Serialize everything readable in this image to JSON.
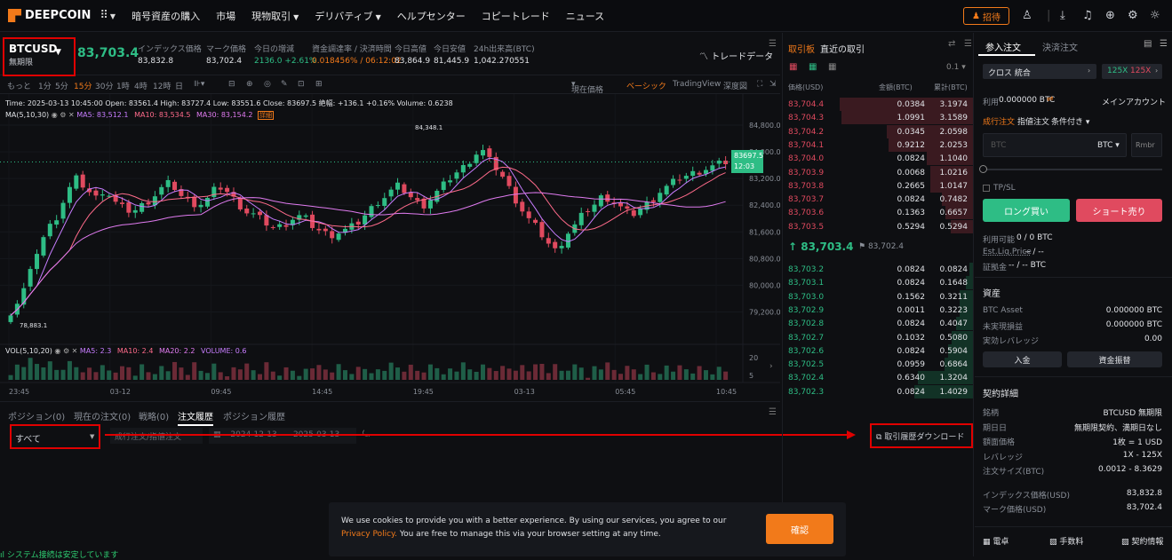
{
  "nav": {
    "logo": "DEEPCOIN",
    "items": [
      "暗号資産の購入",
      "市場",
      "現物取引",
      "デリバティブ",
      "ヘルプセンター",
      "コピートレード",
      "ニュース"
    ],
    "invite": "招待"
  },
  "symbol": {
    "name": "BTCUSD",
    "sub": "無期限",
    "price": "83,703.4",
    "stats": [
      {
        "label": "インデックス価格",
        "value": "83,832.8"
      },
      {
        "label": "マーク価格",
        "value": "83,702.4"
      },
      {
        "label": "今日の増減",
        "value": "2136.0 +2.61%"
      },
      {
        "label": "資金調達率 / 決済時間",
        "value": "0.018456% / 06:12:02"
      },
      {
        "label": "今日高値",
        "value": "83,864.9"
      },
      {
        "label": "今日安値",
        "value": "81,445.9"
      },
      {
        "label": "24h出来高(BTC)",
        "value": "1,042.270551"
      }
    ],
    "trade_data": "トレードデータ"
  },
  "toolbar": {
    "intervals": [
      "もっと",
      "1分",
      "5分",
      "15分",
      "30分",
      "1時",
      "4時",
      "12時",
      "日"
    ],
    "current_price": "現在価格",
    "basic": "ベーシック",
    "tradingview": "TradingView",
    "depth": "深度図"
  },
  "chart_info": {
    "line1": "Time: 2025-03-13 10:45:00   Open: 83561.4   High: 83727.4   Low: 83551.6   Close: 83697.5   絶幅: +136.1 +0.16%   Volume: 0.6238",
    "ma_label": "MA(5,10,30)",
    "ma5": "MA5: 83,512.1",
    "ma10": "MA10: 83,534.5",
    "ma30": "MA30: 83,154.2",
    "badge": "詳細",
    "vol_label": "VOL(5,10,20)",
    "vma5": "MA5: 2.3",
    "vma10": "MA10: 2.4",
    "vma20": "MA20: 2.2",
    "volume": "VOLUME: 0.6",
    "high_mark": "84,348.1",
    "low_mark": "78,883.1",
    "last_price": "83697.5",
    "last_time": "12:03"
  },
  "chart_data": {
    "type": "candlestick",
    "y_ticks": [
      "84,800.0",
      "84,000.0",
      "83,200.0",
      "82,400.0",
      "81,600.0",
      "80,800.0",
      "80,000.0",
      "79,200.0"
    ],
    "y_range": [
      78600,
      85200
    ],
    "x_ticks": [
      "23:45",
      "03-12",
      "09:45",
      "14:45",
      "19:45",
      "03-13",
      "05:45",
      "10:45"
    ],
    "vol_ticks": [
      "20",
      "5"
    ],
    "close": [
      79200,
      79600,
      80300,
      81200,
      81700,
      82100,
      82800,
      83200,
      82900,
      82600,
      82900,
      82500,
      82300,
      82200,
      82400,
      82600,
      82900,
      83100,
      82700,
      82500,
      82400,
      82600,
      83000,
      82800,
      82500,
      82200,
      82100,
      81900,
      81700,
      81800,
      82000,
      82100,
      81800,
      81600,
      81500,
      81600,
      81700,
      81900,
      82200,
      82500,
      82700,
      83000,
      82800,
      82500,
      82400,
      82700,
      83000,
      83300,
      83500,
      83800,
      84100,
      83700,
      83400,
      82900,
      82400,
      82000,
      81700,
      81300,
      81000,
      81500,
      81800,
      82200,
      82400,
      82700,
      82500,
      82300,
      82100,
      82300,
      82500,
      82800,
      83000,
      83200,
      83300,
      83400,
      83500,
      83600,
      83700
    ]
  },
  "bottom": {
    "tabs": [
      "ポジション(0)",
      "現在の注文(0)",
      "戦略(0)",
      "注文履歴",
      "ポジション履歴"
    ],
    "filter_all": "すべて",
    "order_type": "成行注文/指値注文",
    "date_from": "2024-12-13",
    "date_to": "2025-03-13",
    "download": "取引履歴ダウンロード"
  },
  "orderbook": {
    "tab1": "取引板",
    "tab2": "直近の取引",
    "precision": "0.1",
    "headers": [
      "価格(USD)",
      "金額(BTC)",
      "累計(BTC)"
    ],
    "asks": [
      [
        "83,704.4",
        "0.0384",
        "3.1974"
      ],
      [
        "83,704.3",
        "1.0991",
        "3.1589"
      ],
      [
        "83,704.2",
        "0.0345",
        "2.0598"
      ],
      [
        "83,704.1",
        "0.9212",
        "2.0253"
      ],
      [
        "83,704.0",
        "0.0824",
        "1.1040"
      ],
      [
        "83,703.9",
        "0.0068",
        "1.0216"
      ],
      [
        "83,703.8",
        "0.2665",
        "1.0147"
      ],
      [
        "83,703.7",
        "0.0824",
        "0.7482"
      ],
      [
        "83,703.6",
        "0.1363",
        "0.6657"
      ],
      [
        "83,703.5",
        "0.5294",
        "0.5294"
      ]
    ],
    "mid_price": "83,703.4",
    "mid_mark": "83,702.4",
    "bids": [
      [
        "83,703.2",
        "0.0824",
        "0.0824"
      ],
      [
        "83,703.1",
        "0.0824",
        "0.1648"
      ],
      [
        "83,703.0",
        "0.1562",
        "0.3211"
      ],
      [
        "83,702.9",
        "0.0011",
        "0.3223"
      ],
      [
        "83,702.8",
        "0.0824",
        "0.4047"
      ],
      [
        "83,702.7",
        "0.1032",
        "0.5080"
      ],
      [
        "83,702.6",
        "0.0824",
        "0.5904"
      ],
      [
        "83,702.5",
        "0.0959",
        "0.6864"
      ],
      [
        "83,702.4",
        "0.6340",
        "1.3204"
      ],
      [
        "83,702.3",
        "0.0824",
        "1.4029"
      ]
    ]
  },
  "order_panel": {
    "tab1": "参入注文",
    "tab2": "決済注文",
    "margin_mode": "クロス 統合",
    "leverage1": "125X",
    "leverage2": "125X",
    "available_label": "利用",
    "available_value": "0.000000 BTC",
    "main_account": "メインアカウント",
    "order_types": [
      "成行注文",
      "指値注文",
      "条件付き"
    ],
    "qty_placeholder": "BTC",
    "qty_unit": "BTC",
    "rmb": "Rmbr",
    "tpsl": "TP/SL",
    "long": "ロング買い",
    "short": "ショート売り",
    "avail_line": "利用可能",
    "avail_vals": "0 / 0 BTC",
    "liq_line": "Est.Liq.Price",
    "liq_vals": "-- / --",
    "margin_line": "証拠金",
    "margin_vals": "-- / -- BTC",
    "assets_title": "資産",
    "assets": [
      [
        "BTC Asset",
        "0.000000 BTC"
      ],
      [
        "未実現損益",
        "0.000000 BTC"
      ],
      [
        "実効レバレッジ",
        "0.00"
      ]
    ],
    "deposit": "入金",
    "transfer": "資金振替",
    "contract_title": "契約詳細",
    "contract": [
      [
        "銘柄",
        "BTCUSD 無期限"
      ],
      [
        "期日日",
        "無期限契約、満期日なし"
      ],
      [
        "額面価格",
        "1枚 = 1 USD"
      ],
      [
        "レバレッジ",
        "1X - 125X"
      ],
      [
        "注文サイズ(BTC)",
        "0.0012 - 8.3629"
      ]
    ],
    "index_rows": [
      [
        "インデックス価格(USD)",
        "83,832.8"
      ],
      [
        "マーク価格(USD)",
        "83,702.4"
      ]
    ],
    "footer": [
      "電卓",
      "手数料",
      "契約情報"
    ]
  },
  "cookie": {
    "text1": "We use cookies to provide you with a better experience. By using our services, you agree to our",
    "link1": "Privacy",
    "link2": "Policy.",
    "text2": "You are free to manage this via your browser setting at any time.",
    "confirm": "確認"
  },
  "status": "システム接続は安定しています"
}
